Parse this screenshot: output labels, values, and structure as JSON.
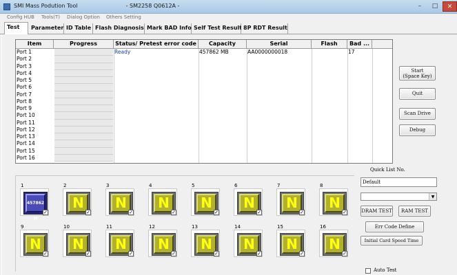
{
  "window": {
    "app_title": "SMI Mass Podution Tool",
    "sub_title": "- SM2258 Q0612A -",
    "minimize_icon": "–",
    "maximize_icon": "□",
    "close_icon": "✕"
  },
  "menu": [
    "Config HUB",
    "Tools(T)",
    "Dialog Option",
    "Others Setting"
  ],
  "tabs": [
    "Test",
    "Parameter",
    "ID Table",
    "Flash Diagnosis",
    "Mark BAD Info",
    "Self Test Result",
    "8P RDT Result"
  ],
  "grid": {
    "headers": [
      "Item",
      "Progress",
      "Status/ Pretest error code",
      "Capacity",
      "Serial",
      "Flash",
      "Bad ..."
    ],
    "rows": [
      {
        "item": "Port 1",
        "status": "Ready",
        "capacity": "457862 MB",
        "serial": "AA0000000018",
        "flash": "",
        "bad": "17"
      },
      {
        "item": "Port 2",
        "status": "",
        "capacity": "",
        "serial": "",
        "flash": "",
        "bad": ""
      },
      {
        "item": "Port 3",
        "status": "",
        "capacity": "",
        "serial": "",
        "flash": "",
        "bad": ""
      },
      {
        "item": "Port 4",
        "status": "",
        "capacity": "",
        "serial": "",
        "flash": "",
        "bad": ""
      },
      {
        "item": "Port 5",
        "status": "",
        "capacity": "",
        "serial": "",
        "flash": "",
        "bad": ""
      },
      {
        "item": "Port 6",
        "status": "",
        "capacity": "",
        "serial": "",
        "flash": "",
        "bad": ""
      },
      {
        "item": "Port 7",
        "status": "",
        "capacity": "",
        "serial": "",
        "flash": "",
        "bad": ""
      },
      {
        "item": "Port 8",
        "status": "",
        "capacity": "",
        "serial": "",
        "flash": "",
        "bad": ""
      },
      {
        "item": "Port 9",
        "status": "",
        "capacity": "",
        "serial": "",
        "flash": "",
        "bad": ""
      },
      {
        "item": "Port 10",
        "status": "",
        "capacity": "",
        "serial": "",
        "flash": "",
        "bad": ""
      },
      {
        "item": "Port 11",
        "status": "",
        "capacity": "",
        "serial": "",
        "flash": "",
        "bad": ""
      },
      {
        "item": "Port 12",
        "status": "",
        "capacity": "",
        "serial": "",
        "flash": "",
        "bad": ""
      },
      {
        "item": "Port 13",
        "status": "",
        "capacity": "",
        "serial": "",
        "flash": "",
        "bad": ""
      },
      {
        "item": "Port 14",
        "status": "",
        "capacity": "",
        "serial": "",
        "flash": "",
        "bad": ""
      },
      {
        "item": "Port 15",
        "status": "",
        "capacity": "",
        "serial": "",
        "flash": "",
        "bad": ""
      },
      {
        "item": "Port 16",
        "status": "",
        "capacity": "",
        "serial": "",
        "flash": "",
        "bad": ""
      }
    ]
  },
  "buttons": {
    "start_line1": "Start",
    "start_line2": "(Space Key)",
    "quit": "Quit",
    "scan_drive": "Scan Drive",
    "debug": "Debug",
    "dram_test": "DRAM TEST",
    "ram_test": "RAM TEST",
    "err_code_define": "Err Code Define",
    "initial_card_speed_time": "Initial Card Speed Time"
  },
  "quick_list": {
    "label": "Quick List No.",
    "value": "Default",
    "select_value": "",
    "dropdown_icon": "▼"
  },
  "auto_test": {
    "label": "Auto Test",
    "checked": false
  },
  "slots": {
    "letter": "N",
    "check_mark": "✓",
    "active_text": "457862 M",
    "numbers": [
      "1",
      "2",
      "3",
      "4",
      "5",
      "6",
      "7",
      "8",
      "9",
      "10",
      "11",
      "12",
      "13",
      "14",
      "15",
      "16"
    ]
  },
  "colors": {
    "slot_yellow": "#b2b12d",
    "slot_letter": "#ffff12",
    "slot_active": "#4a4ab8",
    "ready_text": "#1a3fa0",
    "close_button": "#c74a3c"
  }
}
